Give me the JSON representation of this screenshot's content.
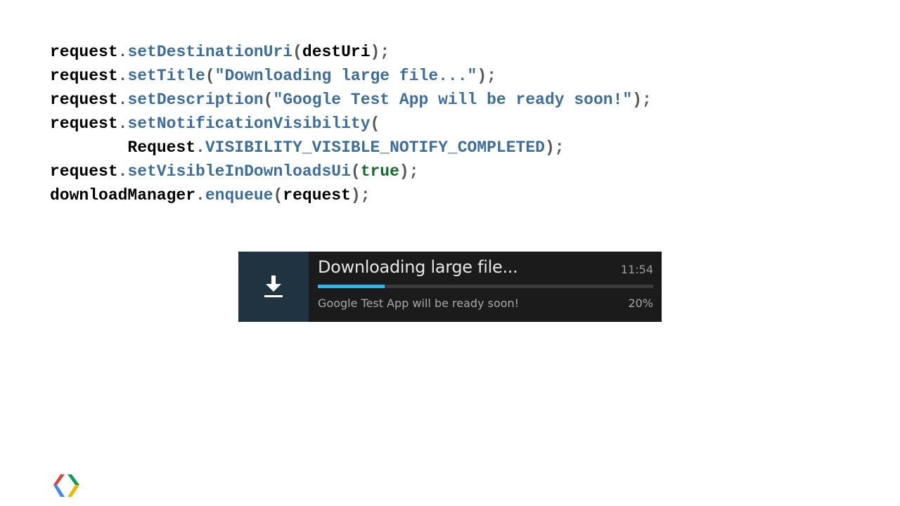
{
  "code": {
    "lines": [
      [
        {
          "t": "request",
          "c": "ident"
        },
        {
          "t": ".",
          "c": "punct"
        },
        {
          "t": "setDestinationUri",
          "c": "method"
        },
        {
          "t": "(",
          "c": "punct"
        },
        {
          "t": "destUri",
          "c": "ident"
        },
        {
          "t": ");",
          "c": "punct"
        }
      ],
      [
        {
          "t": "request",
          "c": "ident"
        },
        {
          "t": ".",
          "c": "punct"
        },
        {
          "t": "setTitle",
          "c": "method"
        },
        {
          "t": "(",
          "c": "punct"
        },
        {
          "t": "\"Downloading large file...\"",
          "c": "str"
        },
        {
          "t": ");",
          "c": "punct"
        }
      ],
      [
        {
          "t": "request",
          "c": "ident"
        },
        {
          "t": ".",
          "c": "punct"
        },
        {
          "t": "setDescription",
          "c": "method"
        },
        {
          "t": "(",
          "c": "punct"
        },
        {
          "t": "\"Google Test App will be ready soon!\"",
          "c": "str"
        },
        {
          "t": ");",
          "c": "punct"
        }
      ],
      [
        {
          "t": "request",
          "c": "ident"
        },
        {
          "t": ".",
          "c": "punct"
        },
        {
          "t": "setNotificationVisibility",
          "c": "method"
        },
        {
          "t": "(",
          "c": "punct"
        }
      ],
      [
        {
          "t": "        ",
          "c": "ident"
        },
        {
          "t": "Request",
          "c": "ident"
        },
        {
          "t": ".",
          "c": "punct"
        },
        {
          "t": "VISIBILITY_VISIBLE_NOTIFY_COMPLETED",
          "c": "method"
        },
        {
          "t": ");",
          "c": "punct"
        }
      ],
      [
        {
          "t": "request",
          "c": "ident"
        },
        {
          "t": ".",
          "c": "punct"
        },
        {
          "t": "setVisibleInDownloadsUi",
          "c": "method"
        },
        {
          "t": "(",
          "c": "punct"
        },
        {
          "t": "true",
          "c": "kw"
        },
        {
          "t": ");",
          "c": "punct"
        }
      ],
      [
        {
          "t": "downloadManager",
          "c": "ident"
        },
        {
          "t": ".",
          "c": "punct"
        },
        {
          "t": "enqueue",
          "c": "method"
        },
        {
          "t": "(",
          "c": "punct"
        },
        {
          "t": "request",
          "c": "ident"
        },
        {
          "t": ");",
          "c": "punct"
        }
      ]
    ]
  },
  "notification": {
    "icon": "download-icon",
    "title": "Downloading large file...",
    "time": "11:54",
    "description": "Google Test App will be ready soon!",
    "percent_label": "20%",
    "progress": 0.2,
    "colors": {
      "background": "#1b1b1b",
      "icon_background": "#1f3440",
      "progress_fill": "#33b5e5",
      "progress_track": "#3a3a3a"
    }
  },
  "logo": {
    "icon": "google-developers-logo-icon"
  }
}
